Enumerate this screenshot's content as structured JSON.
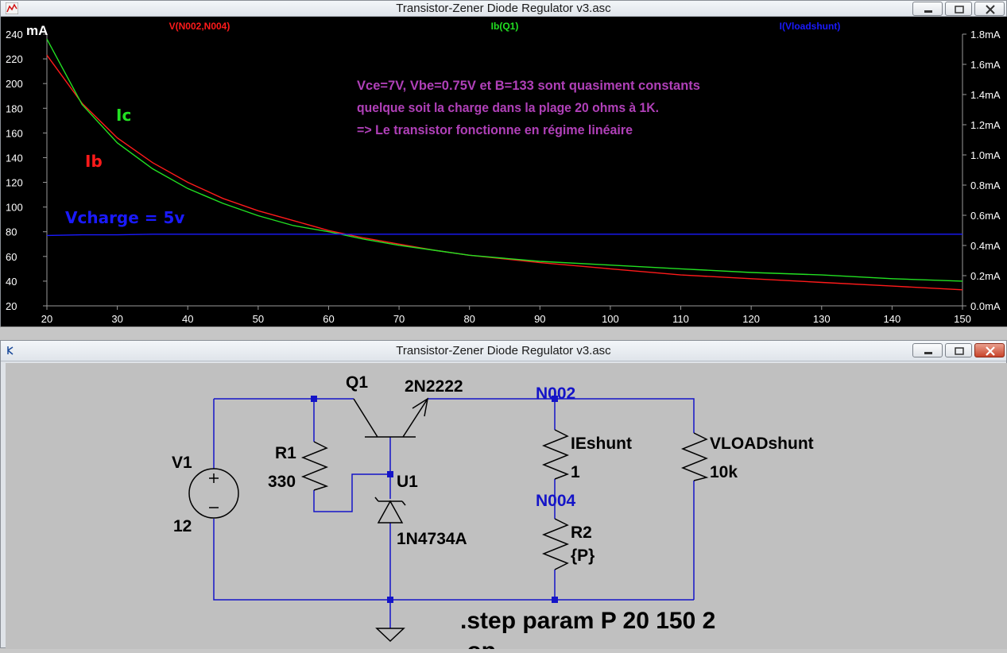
{
  "plot_window": {
    "title": "Transistor-Zener Diode Regulator v3.asc"
  },
  "schematic_window": {
    "title": "Transistor-Zener Diode Regulator v3.asc"
  },
  "colors": {
    "red_trace": "#ff1a1a",
    "green_trace": "#22e022",
    "blue_trace": "#1a1aff",
    "annotation": "#b040b8",
    "wire": "#1414c8",
    "label_blue": "#1414c8"
  },
  "chart_data": {
    "type": "line",
    "left_unit": "mA",
    "x": [
      20,
      25,
      30,
      35,
      40,
      45,
      50,
      55,
      60,
      65,
      70,
      75,
      80,
      90,
      100,
      110,
      120,
      130,
      140,
      150
    ],
    "xticks": [
      "20",
      "30",
      "40",
      "50",
      "60",
      "70",
      "80",
      "90",
      "100",
      "110",
      "120",
      "130",
      "140",
      "150"
    ],
    "xlim": [
      20,
      150
    ],
    "yticks_left": [
      "240",
      "220",
      "200",
      "180",
      "160",
      "140",
      "120",
      "100",
      "80",
      "60",
      "40",
      "20"
    ],
    "ylim_left": [
      20,
      240
    ],
    "yticks_right": [
      "1.8mA",
      "1.6mA",
      "1.4mA",
      "1.2mA",
      "1.0mA",
      "0.8mA",
      "0.6mA",
      "0.4mA",
      "0.2mA",
      "0.0mA"
    ],
    "ylim_right": [
      0,
      1.8
    ],
    "series": [
      {
        "name": "V(N002,N004)",
        "color": "#ff1a1a",
        "axis": "left",
        "values": [
          223,
          184,
          156,
          136,
          120,
          107,
          97,
          89,
          81,
          75,
          70,
          65,
          61,
          55,
          50,
          45,
          42,
          39,
          36,
          33
        ]
      },
      {
        "name": "Ib(Q1)",
        "color": "#22e022",
        "axis": "left",
        "values": [
          236,
          183,
          152,
          131,
          115,
          103,
          93,
          85,
          80,
          74,
          69,
          65,
          61,
          56,
          53,
          50,
          47,
          45,
          42,
          40
        ]
      },
      {
        "name": "I(Vloadshunt)",
        "color": "#1a1aff",
        "axis": "left",
        "values": [
          77,
          77.5,
          77.5,
          78,
          78,
          78,
          78,
          78,
          78,
          78,
          78,
          78,
          78,
          78,
          78,
          78,
          78,
          78,
          78,
          78
        ]
      }
    ],
    "annotations": {
      "ic": "Ic",
      "ib": "Ib",
      "vcharge": "Vcharge = 5v",
      "note_line1": "Vce=7V,  Vbe=0.75V et  B=133 sont quasiment constants",
      "note_line2": "quelque soit la charge dans la plage 20 ohms à 1K.",
      "note_line3": "=> Le transistor fonctionne en régime linéaire"
    }
  },
  "schematic": {
    "v1_name": "V1",
    "v1_value": "12",
    "r1_name": "R1",
    "r1_value": "330",
    "q1_name": "Q1",
    "q1_model": "2N2222",
    "u1_name": "U1",
    "u1_model": "1N4734A",
    "net_n002": "N002",
    "net_n004": "N004",
    "ieshunt_name": "IEshunt",
    "ieshunt_value": "1",
    "r2_name": "R2",
    "r2_value": "{P}",
    "vload_name": "VLOADshunt",
    "vload_value": "10k",
    "directive_step": ".step param P 20 150 2",
    "directive_op": ".op"
  }
}
